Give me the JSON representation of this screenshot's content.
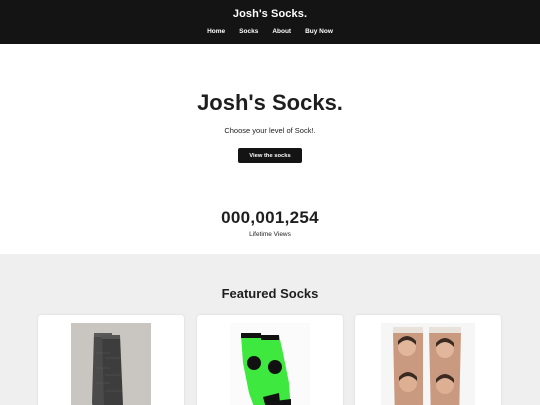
{
  "header": {
    "title": "Josh's Socks.",
    "nav": [
      {
        "label": "Home"
      },
      {
        "label": "Socks"
      },
      {
        "label": "About"
      },
      {
        "label": "Buy Now"
      }
    ]
  },
  "hero": {
    "title": "Josh's Socks.",
    "subtitle": "Choose your level of Sock!.",
    "button_label": "View the socks"
  },
  "stats": {
    "views": "000,001,254",
    "views_label": "Lifetime Views"
  },
  "featured": {
    "title": "Featured Socks",
    "cards": [
      {
        "image": "grey-sock-image"
      },
      {
        "image": "green-black-sock-image"
      },
      {
        "image": "face-print-sock-image"
      }
    ]
  },
  "colors": {
    "header_bg": "#141414",
    "button_bg": "#141414",
    "featured_bg": "#efefef",
    "sock_green": "#3ee83e"
  }
}
